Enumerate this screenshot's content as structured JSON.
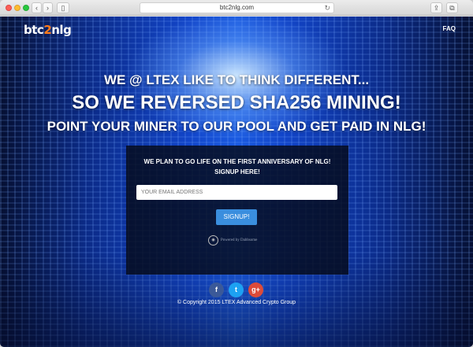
{
  "browser": {
    "url": "btc2nlg.com",
    "reload_icon": "reload-icon"
  },
  "site": {
    "logo_prefix": "btc",
    "logo_two": "2",
    "logo_suffix": "nlg",
    "nav_faq": "FAQ",
    "accent_color": "#ff7a1a"
  },
  "hero": {
    "line1": "WE @ LTEX LIKE TO THINK DIFFERENT...",
    "line2": "SO WE REVERSED SHA256 MINING!",
    "line3": "POINT YOUR MINER TO OUR POOL AND GET PAID IN NLG!"
  },
  "signup": {
    "text_line1": "WE PLAN TO GO LIFE ON THE FIRST ANNIVERSARY OF NLG!",
    "text_line2": "SIGNUP HERE!",
    "email_placeholder": "YOUR EMAIL ADDRESS",
    "button_label": "SIGNUP!",
    "powered_by": "Powered by Dabbsome"
  },
  "footer": {
    "facebook": "f",
    "twitter": "t",
    "googleplus": "g+",
    "copyright": "© Copyright 2015 LTEX Advanced Crypto Group"
  }
}
